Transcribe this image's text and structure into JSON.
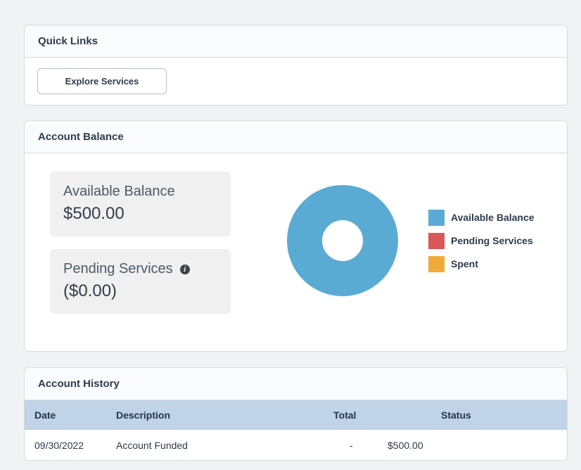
{
  "quick_links": {
    "title": "Quick Links",
    "explore_button": "Explore Services"
  },
  "account_balance": {
    "title": "Account Balance",
    "available_label": "Available Balance",
    "available_value": "$500.00",
    "pending_label": "Pending Services",
    "pending_value": "($0.00)",
    "pending_info_icon": "info-icon",
    "chart_data": {
      "type": "pie",
      "labels": [
        "Available Balance",
        "Pending Services",
        "Spent"
      ],
      "values": [
        500,
        0,
        0
      ],
      "colors": [
        "#5aabd3",
        "#d95756",
        "#efaa3a"
      ],
      "legend_position": "right"
    },
    "legend": [
      {
        "label": "Available Balance",
        "color": "#5aabd3"
      },
      {
        "label": "Pending Services",
        "color": "#d95756"
      },
      {
        "label": "Spent",
        "color": "#efaa3a"
      }
    ]
  },
  "account_history": {
    "title": "Account History",
    "columns": [
      "Date",
      "Description",
      "Total",
      "Status"
    ],
    "rows": [
      {
        "date": "09/30/2022",
        "description": "Account Funded",
        "total": "-",
        "status": "$500.00"
      }
    ]
  }
}
